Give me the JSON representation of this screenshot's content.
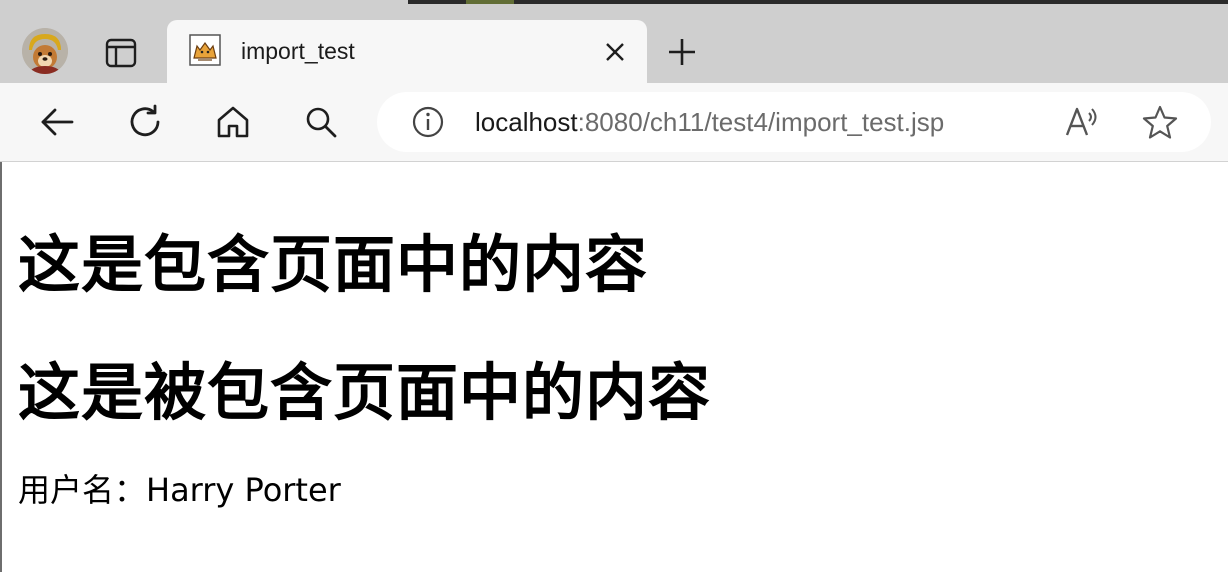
{
  "browser": {
    "tab": {
      "title": "import_test",
      "favicon": "tomcat-favicon-icon"
    },
    "address_bar": {
      "url_host": "localhost",
      "url_rest": ":8080/ch11/test4/import_test.jsp"
    },
    "toolbar_icons": [
      "back-arrow-icon",
      "refresh-icon",
      "home-icon",
      "search-icon",
      "info-icon",
      "read-aloud-icon",
      "favorite-star-icon"
    ],
    "tabstrip_icons": [
      "profile-avatar-icon",
      "tab-actions-icon",
      "close-icon",
      "plus-icon"
    ]
  },
  "page": {
    "heading_1": "这是包含页面中的内容",
    "heading_2": "这是被包含页面中的内容",
    "user_line": "用户名：Harry Porter"
  },
  "colors": {
    "tabstrip_bg": "#cfcfcf",
    "toolbar_bg": "#f7f7f7",
    "url_host": "#1a1a1a",
    "url_rest": "#6b6b6b"
  }
}
